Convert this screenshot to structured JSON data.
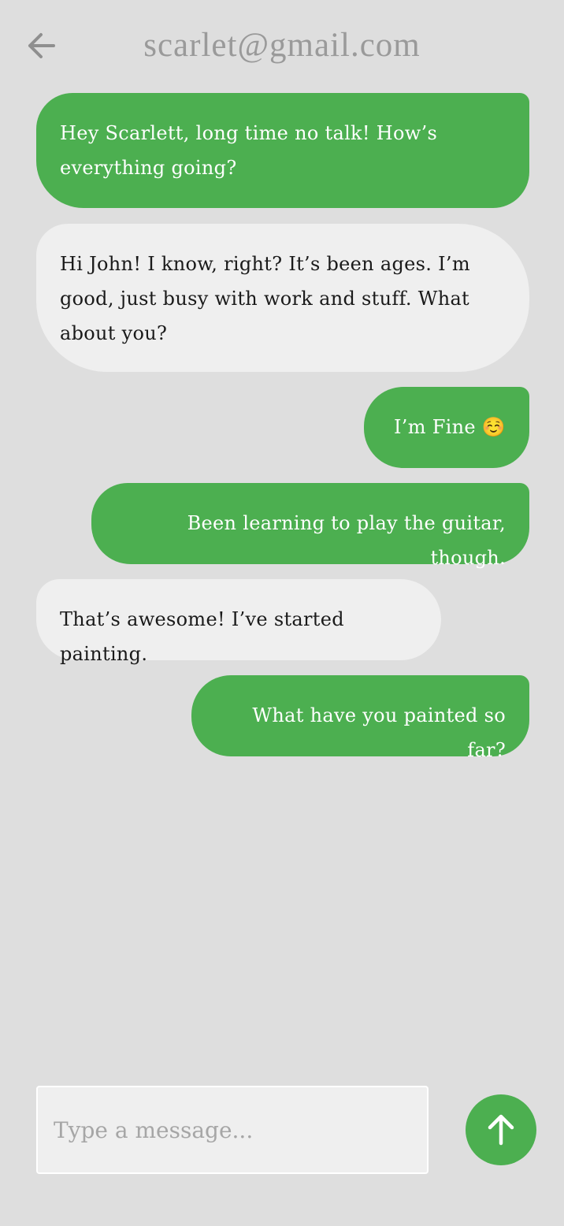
{
  "header": {
    "title": "scarlet@gmail.com",
    "back_icon": "arrow-left-icon"
  },
  "messages": [
    {
      "sender": "me",
      "text": "Hey Scarlett, long time no talk! How’s everything going?"
    },
    {
      "sender": "them",
      "text": "Hi John! I know, right? It’s been ages. I’m good, just busy with work and stuff. What about you?"
    },
    {
      "sender": "me",
      "text": "I’m Fine ☺️"
    },
    {
      "sender": "me",
      "text": "Been learning to play the guitar, though."
    },
    {
      "sender": "them",
      "text": "That’s awesome! I’ve started painting."
    },
    {
      "sender": "me",
      "text": "What have you painted so far?"
    }
  ],
  "composer": {
    "placeholder": "Type a message...",
    "value": "",
    "send_icon": "arrow-up-icon"
  },
  "colors": {
    "background": "#dedede",
    "sent_bubble": "#4caf50",
    "received_bubble": "#efefef",
    "title": "#9a9a9a"
  }
}
